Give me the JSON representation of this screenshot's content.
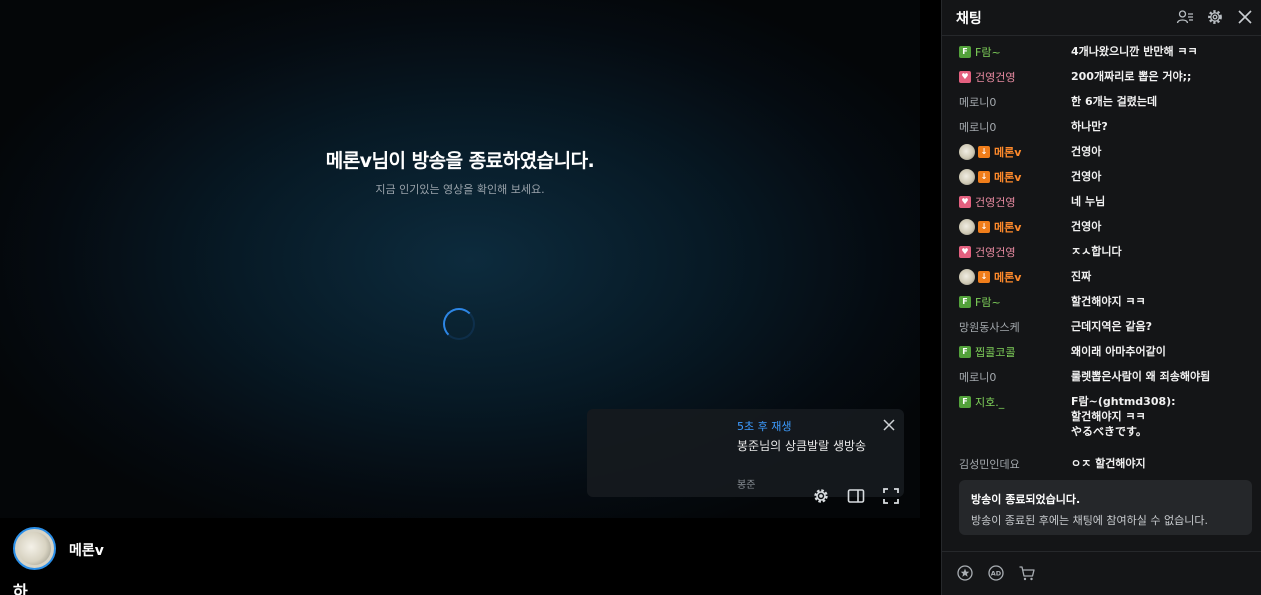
{
  "player": {
    "end_title": "메론v님이 방송을 종료하였습니다.",
    "end_subtitle": "지금 인기있는 영상을 확인해 보세요.",
    "next": {
      "countdown": "5초 후 재생",
      "title": "봉준님의 상큼발랄 생방송",
      "channel": "봉준"
    }
  },
  "channel": {
    "name": "메론v",
    "title": "하"
  },
  "chat": {
    "title": "채팅",
    "messages": [
      {
        "badge": "F",
        "nick": "F람~",
        "text": "4개나왔으니깐 반만해 ㅋㅋ"
      },
      {
        "badge": "S",
        "nick": "건영건영",
        "text": "200개짜리로 뽑은 거야;;"
      },
      {
        "badge": "",
        "nick": "메로니0",
        "text": "한 6개는 걸렸는데"
      },
      {
        "badge": "",
        "nick": "메로니0",
        "text": "하나만?"
      },
      {
        "badge": "B",
        "nick": "메론v",
        "text": "건영아"
      },
      {
        "badge": "B",
        "nick": "메론v",
        "text": "건영아"
      },
      {
        "badge": "S",
        "nick": "건영건영",
        "text": "네 누님"
      },
      {
        "badge": "B",
        "nick": "메론v",
        "text": "건영아"
      },
      {
        "badge": "S",
        "nick": "건영건영",
        "text": "ㅈㅅ합니다"
      },
      {
        "badge": "B",
        "nick": "메론v",
        "text": "진짜"
      },
      {
        "badge": "F",
        "nick": "F람~",
        "text": "할건해야지 ㅋㅋ"
      },
      {
        "badge": "",
        "nick": "망원동사스케",
        "text": "근데지역은 같음?"
      },
      {
        "badge": "F",
        "nick": "찝콜코콜",
        "text": "왜이래 아마추어같이"
      },
      {
        "badge": "",
        "nick": "메로니0",
        "text": "룰렛뽑은사람이 왜 죄송해야됨"
      },
      {
        "badge": "F",
        "nick": "지호._",
        "text_lines": [
          "F람~(ghtmd308):",
          "할건해야지 ㅋㅋ",
          "やるべきです。"
        ]
      },
      {
        "badge": "",
        "nick": "김성민인데요",
        "text": "ㅇㅈ 할건해야지"
      }
    ],
    "ended_notice": {
      "title": "방송이 종료되었습니다.",
      "subtitle": "방송이 종료된 후에는 채팅에 참여하실 수 없습니다."
    }
  },
  "colors": {
    "accent": "#2d86e5",
    "fan_badge": "#53a23b",
    "sub_badge": "#e4607f",
    "bj": "#ff8a2b"
  }
}
